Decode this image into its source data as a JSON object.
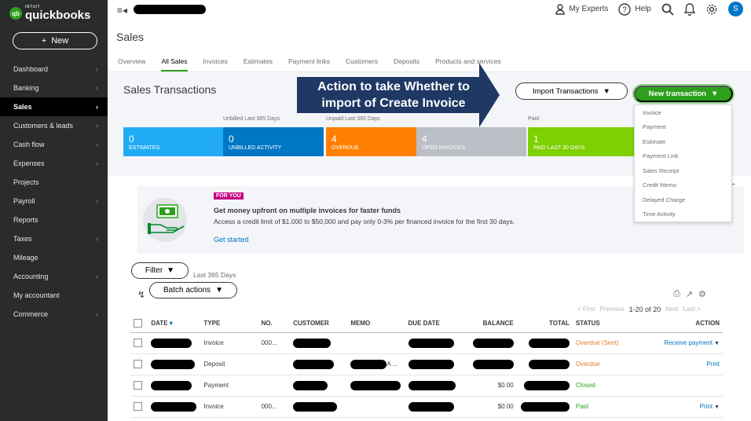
{
  "brand": {
    "intuit": "INTUIT",
    "name": "quickbooks",
    "mark": "qb"
  },
  "sidebar": {
    "new_button": "New",
    "items": [
      {
        "label": "Dashboard",
        "chevron": true,
        "active": false
      },
      {
        "label": "Banking",
        "chevron": true,
        "active": false
      },
      {
        "label": "Sales",
        "chevron": true,
        "active": true
      },
      {
        "label": "Customers & leads",
        "chevron": true,
        "active": false
      },
      {
        "label": "Cash flow",
        "chevron": true,
        "active": false
      },
      {
        "label": "Expenses",
        "chevron": true,
        "active": false
      },
      {
        "label": "Projects",
        "chevron": false,
        "active": false
      },
      {
        "label": "Payroll",
        "chevron": true,
        "active": false
      },
      {
        "label": "Reports",
        "chevron": false,
        "active": false
      },
      {
        "label": "Taxes",
        "chevron": true,
        "active": false
      },
      {
        "label": "Mileage",
        "chevron": false,
        "active": false
      },
      {
        "label": "Accounting",
        "chevron": true,
        "active": false
      },
      {
        "label": "My accountant",
        "chevron": false,
        "active": false
      },
      {
        "label": "Commerce",
        "chevron": true,
        "active": false
      }
    ]
  },
  "topbar": {
    "my_experts": "My Experts",
    "help": "Help",
    "avatar_initial": "S"
  },
  "page": {
    "title": "Sales"
  },
  "tabs": [
    "Overview",
    "All Sales",
    "Invoices",
    "Estimates",
    "Payment links",
    "Customers",
    "Deposits",
    "Products and services"
  ],
  "active_tab": "All Sales",
  "section": {
    "title": "Sales Transactions",
    "import_button": "Import Transactions",
    "new_transaction_button": "New transaction",
    "callout": [
      "Action to take Whether to",
      "import of Create Invoice"
    ],
    "period_labels": {
      "unbilled": "Unbilled Last 365 Days",
      "unpaid": "Unpaid Last 365 Days",
      "paid": "Paid"
    },
    "money_bar": [
      {
        "value": "0",
        "label": "ESTIMATES",
        "color": "#21abf6"
      },
      {
        "value": "0",
        "label": "UNBILLED ACTIVITY",
        "color": "#0077c5"
      },
      {
        "value": "4",
        "label": "OVERDUE",
        "color": "#ff8000"
      },
      {
        "value": "4",
        "label": "OPEN INVOICES",
        "color": "#babec5"
      },
      {
        "value": "1",
        "label": "PAID LAST 30 DAYS",
        "color": "#7fd000"
      }
    ]
  },
  "new_transaction_menu": [
    "Invoice",
    "Payment",
    "Estimate",
    "Payment Link",
    "Sales Receipt",
    "Credit Memo",
    "Delayed Charge",
    "Time Activity"
  ],
  "banner": {
    "tag": "FOR YOU",
    "headline": "Get money upfront on multiple invoices for faster funds",
    "body": "Access a credit limit of $1,000 to $50,000 and pay only 0-3% per financed invoice for the first 30 days.",
    "link": "Get started"
  },
  "filter": {
    "button": "Filter",
    "note": "Last 365 Days"
  },
  "batch": {
    "button": "Batch actions"
  },
  "pager": {
    "first": "< First",
    "previous": "Previous",
    "range": "1-20 of 20",
    "next": "Next",
    "last": "Last >"
  },
  "table": {
    "headers": [
      "DATE",
      "TYPE",
      "NO.",
      "CUSTOMER",
      "MEMO",
      "DUE DATE",
      "BALANCE",
      "TOTAL",
      "STATUS",
      "ACTION"
    ],
    "rows": [
      {
        "type": "Invoice",
        "no": "000...",
        "memo_text": "",
        "balance": "",
        "status": "Overdue (Sent)",
        "status_kind": "overdue",
        "action": "Receive payment",
        "action_caret": true
      },
      {
        "type": "Deposit",
        "no": "",
        "memo_text": "A ...",
        "balance": "",
        "status": "Overdue",
        "status_kind": "overdue",
        "action": "Print",
        "action_caret": false
      },
      {
        "type": "Payment",
        "no": "",
        "memo_text": "",
        "balance": "$0.00",
        "status": "Closed",
        "status_kind": "closed",
        "action": "",
        "action_caret": false
      },
      {
        "type": "Invoice",
        "no": "000...",
        "memo_text": "",
        "balance": "$0.00",
        "status": "Paid",
        "status_kind": "paid",
        "action": "Print",
        "action_caret": true
      }
    ]
  }
}
